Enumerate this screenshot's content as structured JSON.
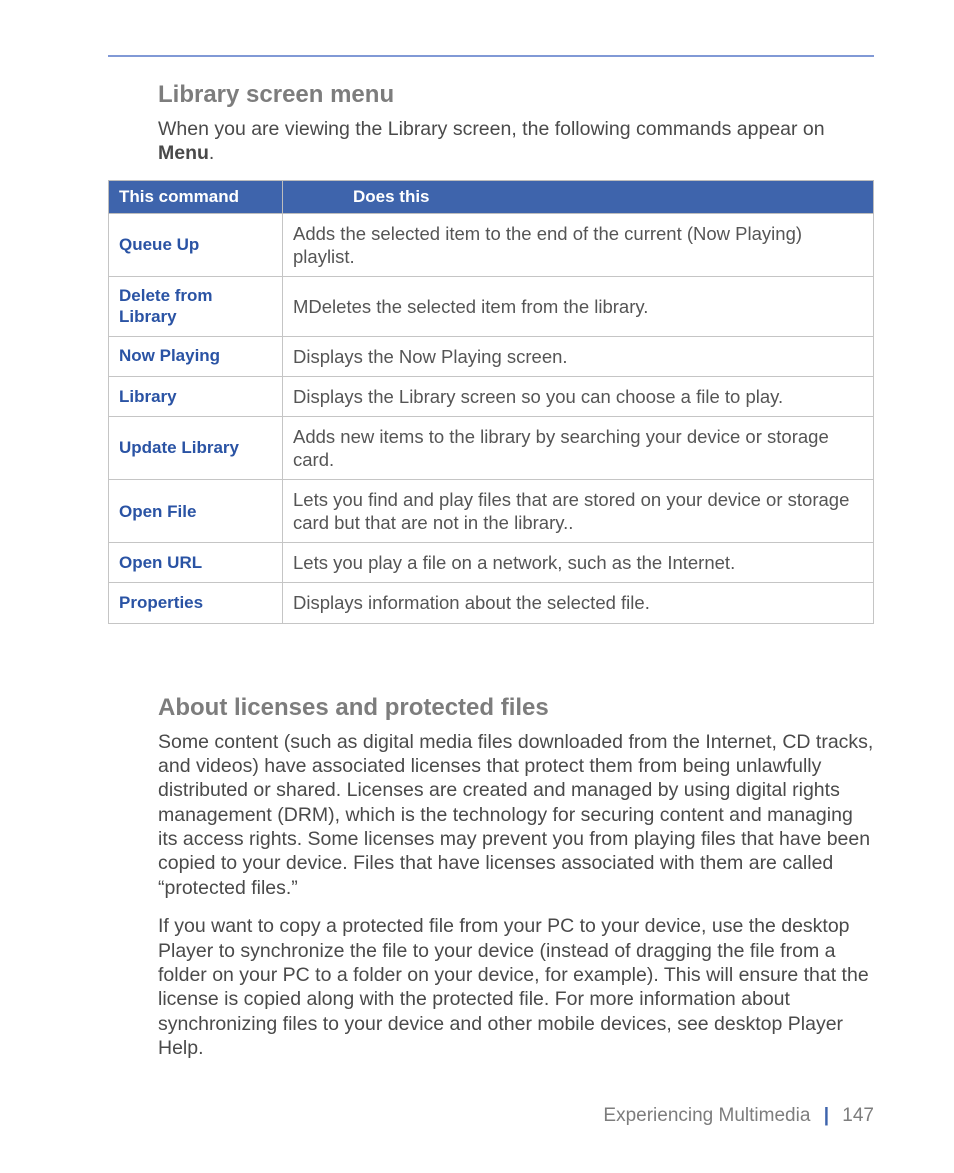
{
  "section1": {
    "title": "Library screen menu",
    "intro_a": "When you are viewing the Library screen, the following commands appear on ",
    "intro_bold": "Menu",
    "intro_b": "."
  },
  "table": {
    "headers": {
      "col1": "This command",
      "col2": "Does this"
    },
    "rows": [
      {
        "cmd": "Queue Up",
        "desc": "Adds the selected item to the end of the current (Now Playing) playlist."
      },
      {
        "cmd": "Delete from Library",
        "desc": "MDeletes the selected item from the library."
      },
      {
        "cmd": "Now Playing",
        "desc": "Displays the Now Playing screen."
      },
      {
        "cmd": "Library",
        "desc": "Displays the Library screen so you can choose a file to play."
      },
      {
        "cmd": "Update Library",
        "desc": "Adds new items to the library by searching your device or storage card."
      },
      {
        "cmd": "Open File",
        "desc": "Lets you find and play files that are stored on your device or storage card but that are not in the library.."
      },
      {
        "cmd": "Open URL",
        "desc": "Lets you play a file on a network, such as the Internet."
      },
      {
        "cmd": "Properties",
        "desc": "Displays information about the selected file."
      }
    ]
  },
  "section2": {
    "title": "About licenses and protected files",
    "p1": "Some content (such as digital media files downloaded from the Internet, CD tracks, and videos) have associated licenses that protect them from being unlawfully distributed or shared. Licenses are created and managed by using digital rights management (DRM), which is the technology for securing content and managing its access rights. Some licenses may prevent you from playing files that have been copied to your device. Files that have licenses associated with them are called “protected files.”",
    "p2": "If you want to copy a protected file from your PC to your device, use the desktop Player to synchronize the file to your device (instead of dragging the file from a folder on your PC to a folder on your device, for example). This will ensure that the license is copied along with the protected file. For more information about synchronizing files to your device and other mobile devices, see desktop Player Help."
  },
  "footer": {
    "chapter": "Experiencing Multimedia",
    "page": "147"
  }
}
